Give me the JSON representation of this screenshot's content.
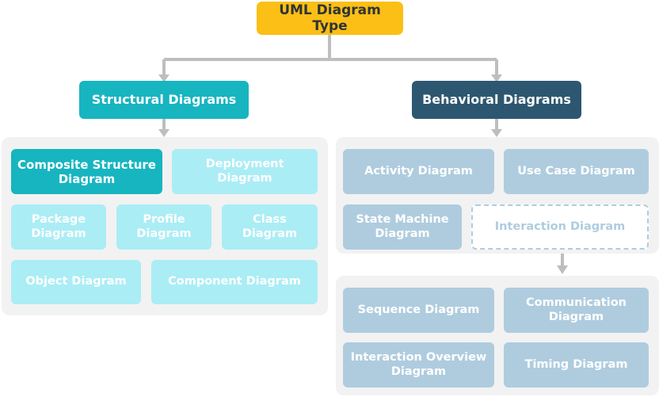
{
  "diagram": {
    "title": "UML Diagram Type",
    "root": {
      "label": "UML Diagram Type",
      "color": "#FBBF15",
      "text_color": "#2F3337"
    },
    "branches": [
      {
        "label": "Structural Diagrams",
        "color": "#17B5C0",
        "text_color": "#FFFFFF"
      },
      {
        "label": "Behavioral Diagrams",
        "color": "#2D5770",
        "text_color": "#FFFFFF"
      }
    ],
    "structural_group": {
      "panel_color": "#F2F2F2",
      "items": [
        {
          "label": "Composite Structure Diagram",
          "style": "highlight",
          "color": "#17B5C0"
        },
        {
          "label": "Deployment Diagram",
          "style": "normal",
          "color": "#ABEDF5"
        },
        {
          "label": "Package Diagram",
          "style": "normal",
          "color": "#ABEDF5"
        },
        {
          "label": "Profile Diagram",
          "style": "normal",
          "color": "#ABEDF5"
        },
        {
          "label": "Class Diagram",
          "style": "normal",
          "color": "#ABEDF5"
        },
        {
          "label": "Object Diagram",
          "style": "normal",
          "color": "#ABEDF5"
        },
        {
          "label": "Component Diagram",
          "style": "normal",
          "color": "#ABEDF5"
        }
      ]
    },
    "behavioral_group": {
      "panel_color": "#F2F2F2",
      "items": [
        {
          "label": "Activity Diagram",
          "style": "normal",
          "color": "#AFCCDF"
        },
        {
          "label": "Use Case Diagram",
          "style": "normal",
          "color": "#AFCCDF"
        },
        {
          "label": "State Machine Diagram",
          "style": "normal",
          "color": "#AFCCDF"
        },
        {
          "label": "Interaction Diagram",
          "style": "dashed",
          "color": "#FFFFFF"
        }
      ]
    },
    "interaction_group": {
      "panel_color": "#F2F2F2",
      "items": [
        {
          "label": "Sequence Diagram",
          "style": "normal",
          "color": "#AFCCDF"
        },
        {
          "label": "Communication Diagram",
          "style": "normal",
          "color": "#AFCCDF"
        },
        {
          "label": "Interaction Overview Diagram",
          "style": "normal",
          "color": "#AFCCDF"
        },
        {
          "label": "Timing Diagram",
          "style": "normal",
          "color": "#AFCCDF"
        }
      ]
    },
    "connector_color": "#BCBEC0"
  }
}
